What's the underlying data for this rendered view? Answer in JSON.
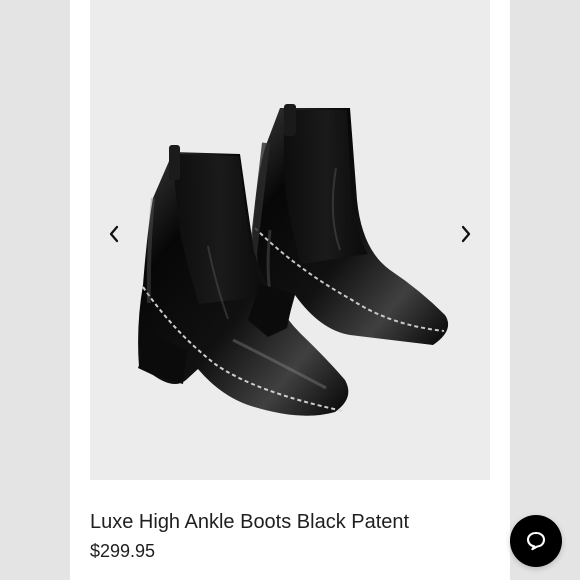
{
  "product": {
    "title": "Luxe High Ankle Boots Black Patent",
    "price": "$299.95"
  },
  "gallery": {
    "image_subject": "black patent ankle boots",
    "left_arrow_icon": "chevron-left-icon",
    "right_arrow_icon": "chevron-right-icon"
  },
  "chat": {
    "icon": "chat-bubble-icon"
  },
  "colors": {
    "card_background": "#ffffff",
    "gallery_background": "#ececec",
    "text_primary": "#1f1f1f",
    "chat_button": "#000000"
  }
}
